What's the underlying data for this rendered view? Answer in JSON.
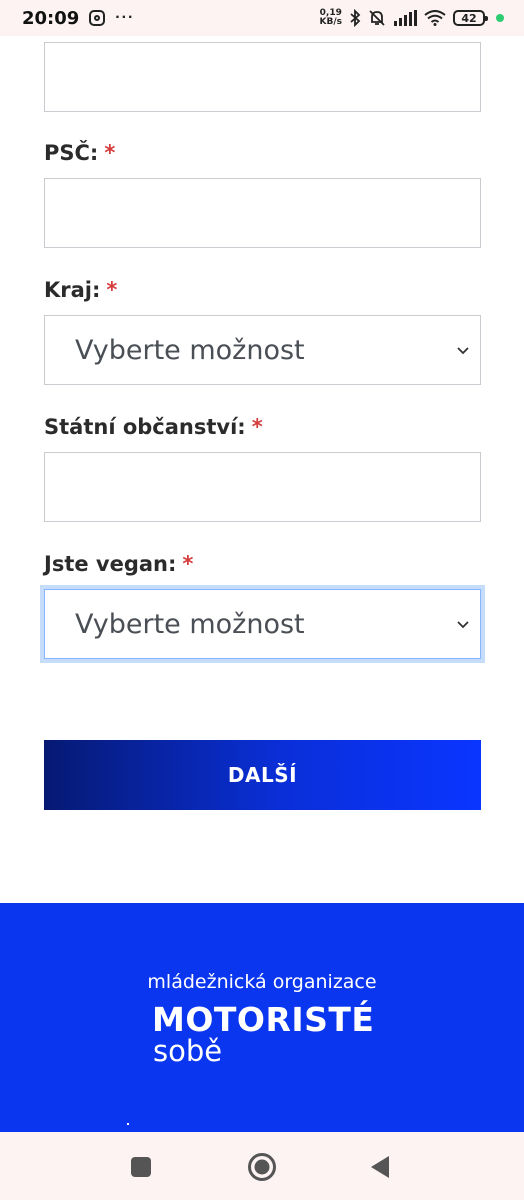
{
  "status_bar": {
    "time": "20:09",
    "net_speed_value": "0,19",
    "net_speed_unit": "KB/s",
    "battery": "42",
    "icons": [
      "instagram-icon",
      "more-dots-icon",
      "bluetooth-icon",
      "bell-muted-icon",
      "signal-icon",
      "wifi-icon",
      "battery-icon",
      "charging-dot"
    ]
  },
  "form": {
    "fields": [
      {
        "label": "PSČ:",
        "required_mark": "*"
      },
      {
        "label": "Kraj:",
        "required_mark": "*",
        "value": "Vyberte možnost"
      },
      {
        "label": "Státní občanství:",
        "required_mark": "*"
      },
      {
        "label": "Jste vegan:",
        "required_mark": "*",
        "value": "Vyberte možnost"
      }
    ],
    "next_button": "DALŠÍ"
  },
  "footer": {
    "tagline": "mládežnická organizace",
    "logo_main": "MOTORISTÉ",
    "logo_sub": "sobě"
  },
  "colors": {
    "accent": "#0a36ef",
    "required": "#d63c3c",
    "focus_ring": "#c5dcfb"
  }
}
